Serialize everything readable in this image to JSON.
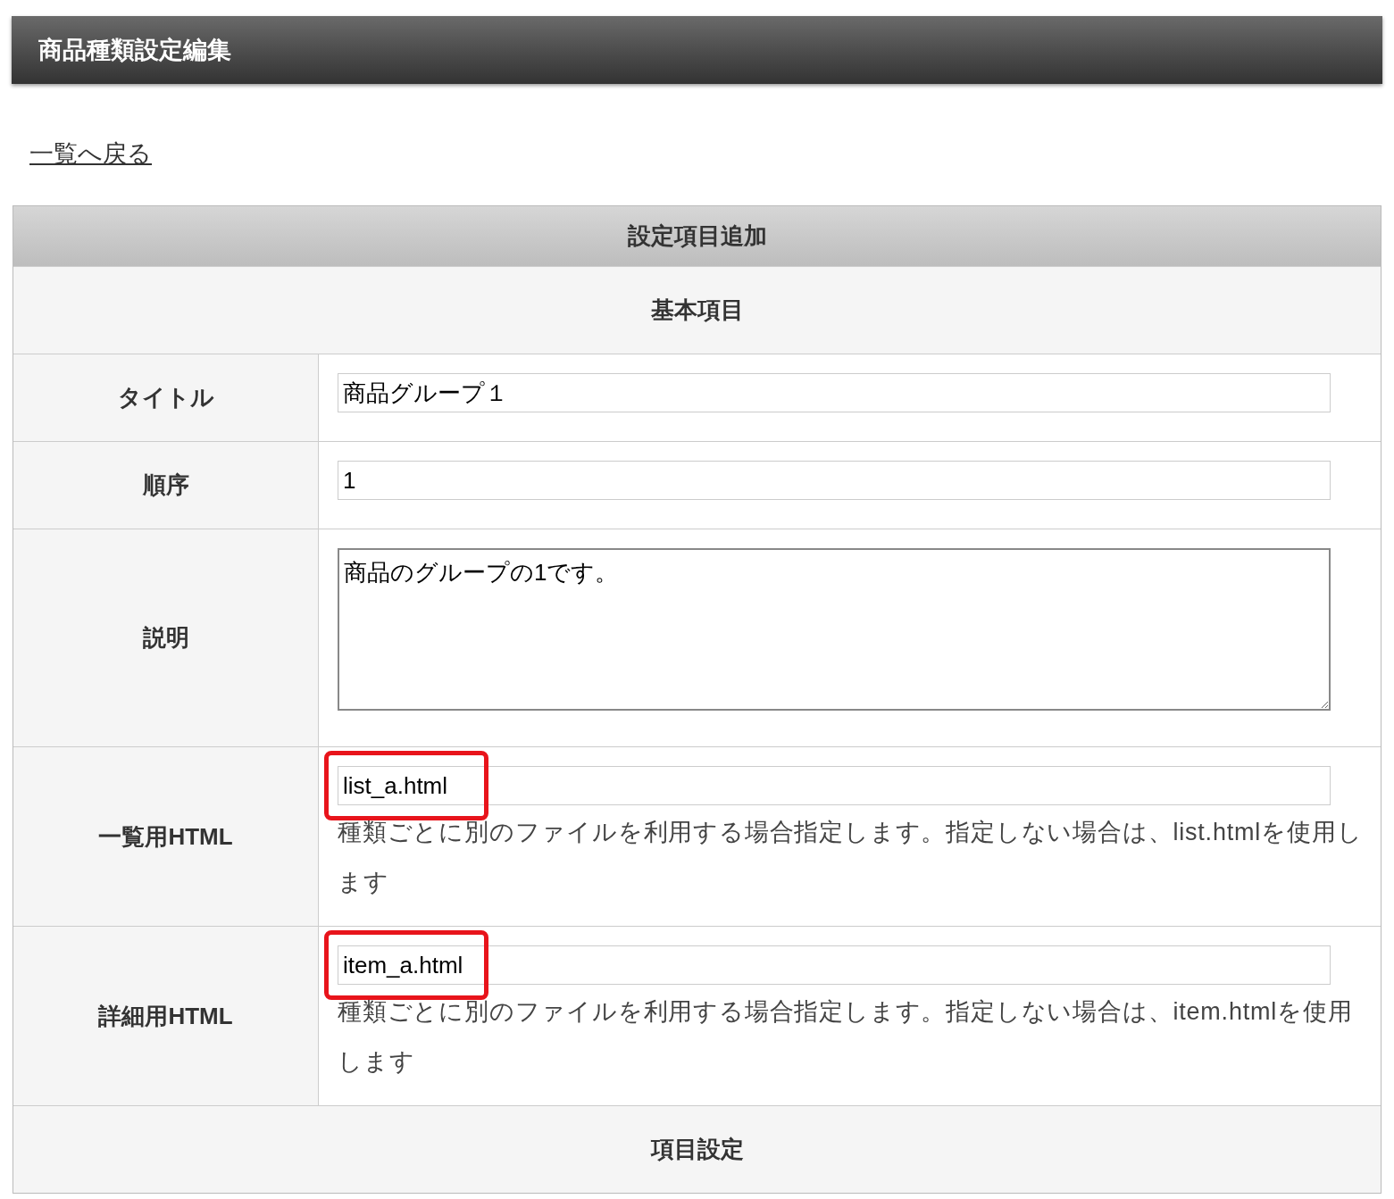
{
  "header": {
    "title": "商品種類設定編集"
  },
  "back_link": "一覧へ戻る",
  "table": {
    "title": "設定項目追加",
    "section": "基本項目",
    "rows": [
      {
        "kind": "input",
        "label": "タイトル",
        "value": "商品グループ１",
        "highlighted": false
      },
      {
        "kind": "input",
        "label": "順序",
        "value": "1",
        "highlighted": false
      },
      {
        "kind": "textarea",
        "label": "説明",
        "value": "商品のグループの1です。",
        "highlighted": false
      },
      {
        "kind": "input",
        "label": "一覧用HTML",
        "value": "list_a.html",
        "highlighted": true,
        "note": "種類ごとに別のファイルを利用する場合指定します。指定しない場合は、list.htmlを使用します"
      },
      {
        "kind": "input",
        "label": "詳細用HTML",
        "value": "item_a.html",
        "highlighted": true,
        "note": "種類ごとに別のファイルを利用する場合指定します。指定しない場合は、item.htmlを使用します"
      }
    ],
    "next_section": "項目設定"
  }
}
